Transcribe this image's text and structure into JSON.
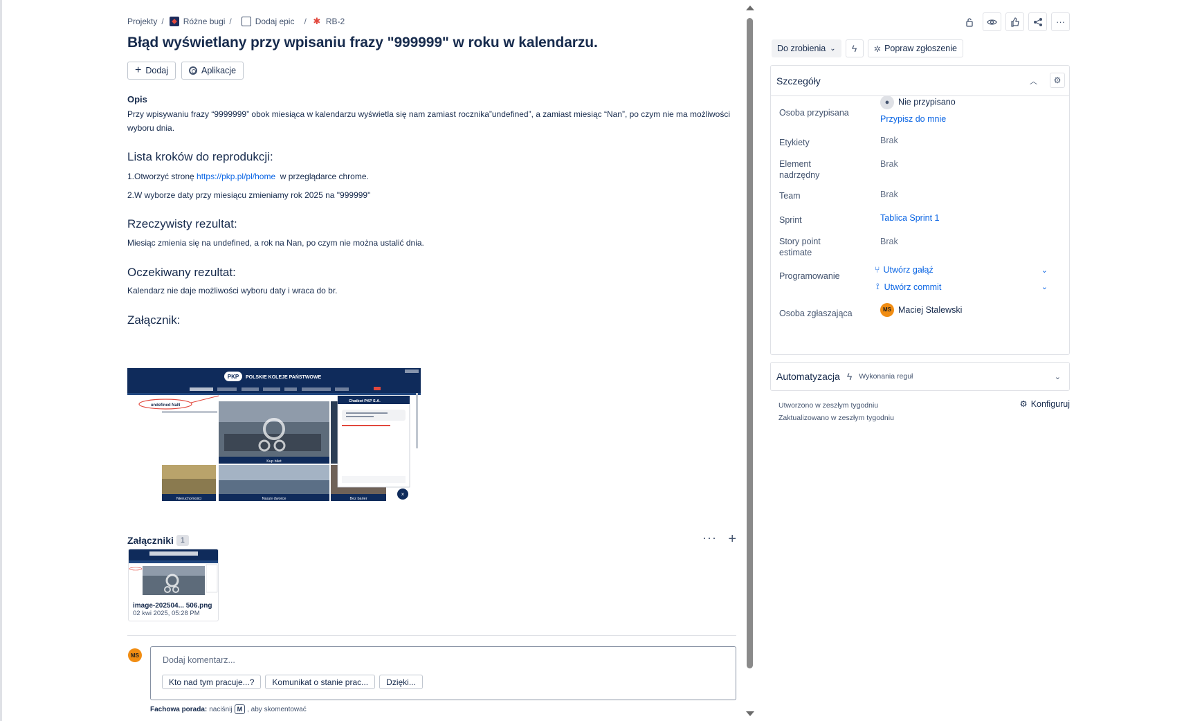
{
  "breadcrumb": {
    "projects": "Projekty",
    "project": "Różne bugi",
    "add_epic": "Dodaj epic",
    "issue_key": "RB-2"
  },
  "issue": {
    "title": "Błąd wyświetlany przy wpisaniu frazy \"999999\" w roku w kalendarzu.",
    "add_label": "Dodaj",
    "apps_label": "Aplikacje"
  },
  "description": {
    "label": "Opis",
    "intro": "Przy wpisywaniu frazy “9999999” obok miesiąca w kalendarzu wyświetla się nam zamiast rocznika”undefined”, a zamiast miesiąc “Nan”, po czym nie ma możliwości wyboru dnia.",
    "steps_heading": "Lista kroków do reprodukcji:",
    "step1_prefix": "1.Otworzyć stronę",
    "step1_link": "https://pkp.pl/pl/home",
    "step1_suffix": " w przeglądarce chrome.",
    "step2": "2.W wyborze daty przy miesiącu zmieniamy rok 2025 na \"999999\"",
    "actual_heading": "Rzeczywisty rezultat:",
    "actual_text": "Miesiąc zmienia się na undefined, a rok na Nan, po czym nie można ustalić dnia.",
    "expected_heading": "Oczekiwany rezultat:",
    "expected_text": "Kalendarz nie daje możliwości wyboru daty i wraca do br.",
    "attachment_heading": "Załącznik:"
  },
  "screenshot": {
    "brand": "POLSKIE KOLEJE PAŃSTWOWE",
    "highlight": "undefined NaN",
    "chat_title": "Chatbot PKP S.A.",
    "tile1": "Kup bilet",
    "tile2": "Nieruchomości",
    "tile3": "Nasze dworce",
    "tile4": "Bez barier"
  },
  "attachments": {
    "title": "Załączniki",
    "count": "1",
    "more": "···",
    "add": "+",
    "file_name": "image-202504... 506.png",
    "file_date": "02 kwi 2025, 05:28 PM"
  },
  "comment": {
    "avatar": "MS",
    "placeholder": "Dodaj komentarz...",
    "quick1": "Kto nad tym pracuje...?",
    "quick2": "Komunikat o stanie prac...",
    "quick3": "Dzięki...",
    "tip_bold": "Fachowa porada:",
    "tip_pre": "naciśnij",
    "tip_key": "M",
    "tip_post": ", aby skomentować"
  },
  "sidebar": {
    "status": "Do zrobienia",
    "improve": "Popraw zgłoszenie",
    "details_title": "Szczegóły",
    "assignee_label": "Osoba przypisana",
    "assignee_value": "Nie przypisano",
    "assign_me": "Przypisz do mnie",
    "labels_label": "Etykiety",
    "labels_value": "Brak",
    "parent_label_1": "Element",
    "parent_label_2": "nadrzędny",
    "parent_value": "Brak",
    "team_label": "Team",
    "team_value": "Brak",
    "sprint_label": "Sprint",
    "sprint_value": "Tablica Sprint 1",
    "sp_label_1": "Story point",
    "sp_label_2": "estimate",
    "sp_value": "Brak",
    "dev_label": "Programowanie",
    "create_branch": "Utwórz gałąź",
    "create_commit": "Utwórz commit",
    "reporter_label": "Osoba zgłaszająca",
    "reporter_avatar": "MS",
    "reporter_name": "Maciej Stalewski",
    "automation_title": "Automatyzacja",
    "automation_sub": "Wykonania reguł",
    "created": "Utworzono w zeszłym tygodniu",
    "updated": "Zaktualizowano w zeszłym tygodniu",
    "configure": "Konfiguruj"
  },
  "colors": {
    "link": "#0c66e4",
    "avatar": "#f18d13",
    "pkp_navy": "#0f2b5b",
    "bug_red": "#e2483d"
  }
}
